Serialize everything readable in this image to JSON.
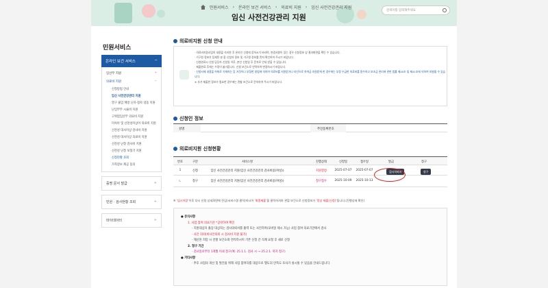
{
  "header": {
    "breadcrumb": [
      "민원서비스",
      "온라인 보건 서비스",
      "의료비 지원",
      "임신 사전건강관리 지원"
    ],
    "title": "임신 사전건강관리 지원",
    "search_placeholder": "검색어를 입력해주세요"
  },
  "sidebar": {
    "title": "민원서비스",
    "active_section": "온라인 보건 서비스",
    "items": [
      {
        "label": "임산부 지원",
        "type": "row"
      },
      {
        "label": "의료비 지원",
        "type": "head"
      },
      {
        "label": "신청방법 안내",
        "type": "child"
      },
      {
        "label": "임신 사전건강관리 지원",
        "type": "on"
      },
      {
        "label": "영구 불임 예방 난자·정자 냉동 지원",
        "type": "child"
      },
      {
        "label": "난임부부 시술비 지원",
        "type": "child"
      },
      {
        "label": "고위험임산부 의료비 지원",
        "type": "child"
      },
      {
        "label": "미숙아 및 선천성이상아 의료비 지원",
        "type": "child"
      },
      {
        "label": "선천성 대사이상 검사비 지원",
        "type": "child"
      },
      {
        "label": "선천성 대사이상 의료비 지원",
        "type": "child"
      },
      {
        "label": "선천성 난청 검사비 지원",
        "type": "child"
      },
      {
        "label": "선천성 난청 보청기 지원",
        "type": "child"
      },
      {
        "label": "신청현황 조회",
        "type": "blue"
      },
      {
        "label": "가족정보 제공 동의",
        "type": "child"
      }
    ],
    "boxes": [
      "증명 문서 발급",
      "민원 · 검사현황 조회",
      "마이데이터"
    ]
  },
  "main": {
    "notice_title": "의료비지원 신청 안내",
    "notice_lines": [
      {
        "text": "· 의료비지원사업의 내용을 숙지한 후 온라인 신청에 응하시기 바라며, 변경사항이 있는 경우 신청정보 상 결과화면을 확인 수 있습니다.",
        "style": ""
      },
      {
        "text": "· 가구원 정보가 등재된 분 중 신청자 정보 및 가구원 정보를 먼저 확인하여 주시기 바랍니다.",
        "style": ""
      },
      {
        "text": "· 신청완료시 신청 담당자 신청일 이후, 본인 신청일 후 문자로 안내 받을 수 있습니다.",
        "style": ""
      },
      {
        "text": "· 제출완료 후에는 수정이 불가합니다. 신청 보건소로 연락하여 변경하시기 바랍니다.",
        "style": ""
      },
      {
        "text": "· 신청서에 내용을 허위로 기재하는 등 거짓이나 부정한 방법에 의하여 의료비를 지원받거나 타인으로 하여금 지원받게 한 경우에는 부정 수급한 의료비를 환수하고 보조금 관리에 관한 법률 제40조 및 제41조에 의하여 처벌될 수 있습니다.",
        "style": "blue"
      },
      {
        "text": "※ 추가 제출한 정보가 필요한 경우에는 관할 보건소로 문의하여 주시기 바랍니다.",
        "style": ""
      }
    ],
    "applicant_title": "신청인 정보",
    "applicant": {
      "name_label": "성명",
      "rrn_label": "주민등록번호"
    },
    "status_title": "의료비지원 신청현황",
    "columns": [
      "번호",
      "구분",
      "서비스명",
      "진행상태",
      "신청일",
      "접수일",
      "발급",
      "청구"
    ],
    "rows": [
      {
        "no": "1",
        "kind": "신청",
        "service": "임신 사전건강관리 지원(임신 사전건강관리 검사비용(여성))",
        "status": "지원결정",
        "applied": "2025-07-07",
        "received": "2025-07-07",
        "issue_btn": "검사의뢰서",
        "claim_btn": "청구"
      },
      {
        "no": "ㄴ",
        "kind": "청구",
        "service": "임신 사전건강관리 지원(임신 사전건강관리 검사비용(여성))",
        "status": "청구접수",
        "applied": "2025-10-09",
        "received": "2025-10-13",
        "issue_btn": "",
        "claim_btn": ""
      }
    ],
    "footnote": {
      "a": "※ '",
      "b": "임시저장",
      "c": "'이후 다시 신청 상세화면에 진입(서비스명 클릭)하시어 '",
      "d": "최종제출",
      "e": "'을 클릭하셔야 관할 보건소로 신청정보가 '",
      "f": "정상 제출(신청)",
      "g": "'됩니다.(진행상태 확인)"
    },
    "guide": {
      "title": "유의사항",
      "step1": "1. 사업 참여 의료기관 *공락하여 확인",
      "l1": "· 지원대상자 출장 대상자는 검사의뢰서를 출력 또는 사전하여(모바일 제시 가능) 사업 참여 의료기관에서 검사",
      "l2": "· 사전 의뢰(비사전의뢰 시 검사비 지원 불가)",
      "l3": "· 해산된 희망 시 관할 보건소와 면작하시어 기존 신청 건 삭제 요청 후 새로 신청",
      "step2": "2. 청구 기간",
      "l4": "· 검사일로부터 1개월 이내 청구(예: 25.1.1. 검사 시 → 25.2.1. 까지 청구)",
      "other": "기타사항",
      "l5": "· 추후 사업의 개선 및 발전을 위해 사업 참여자를 대상으로 별도의 만족도 조사가 실시될 수 있음을 안내드립니다."
    }
  },
  "colors": {
    "accent": "#1d5aa4",
    "banner": "#dbeee6",
    "highlight_ring": "#e01b1b"
  }
}
